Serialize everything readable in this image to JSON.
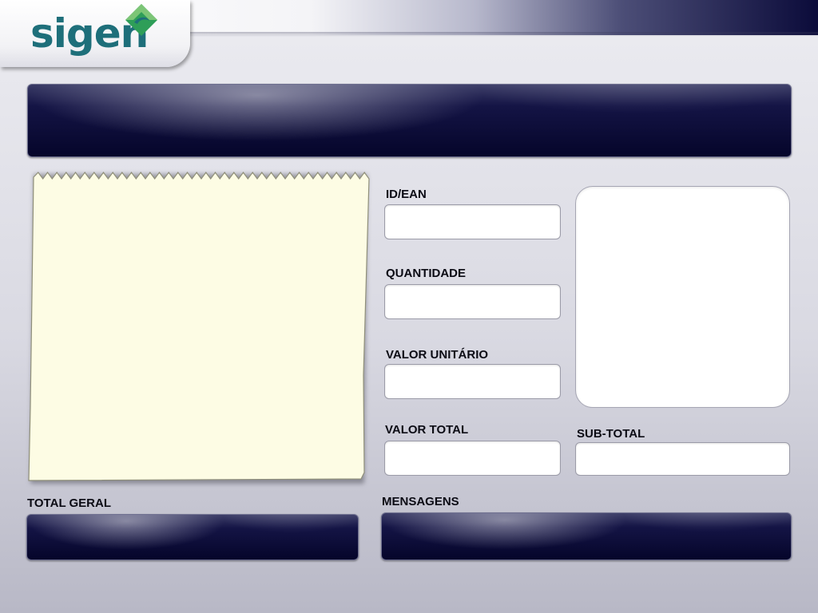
{
  "header": {
    "logo_text": "sigen",
    "brand_colors": {
      "teal": "#1e6f7a",
      "green": "#2e9e58",
      "navy": "#0b0b3a"
    }
  },
  "receipt": {
    "icon": "receipt-paper",
    "color": "#fdfce4"
  },
  "fields": {
    "id_ean": {
      "label": "ID/EAN",
      "value": ""
    },
    "quantidade": {
      "label": "QUANTIDADE",
      "value": ""
    },
    "valor_unitario": {
      "label": "VALOR UNITÁRIO",
      "value": ""
    },
    "valor_total": {
      "label": "VALOR TOTAL",
      "value": ""
    },
    "sub_total": {
      "label": "SUB-TOTAL",
      "value": ""
    }
  },
  "total_geral": {
    "label": "TOTAL GERAL",
    "value": ""
  },
  "mensagens": {
    "label": "MENSAGENS",
    "value": ""
  }
}
